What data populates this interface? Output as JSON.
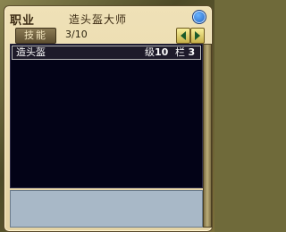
{
  "window": {
    "title": "职业",
    "subtitle": "造头盔大师"
  },
  "header": {
    "tab_label": "技能",
    "count": "3/10"
  },
  "list": {
    "rows": [
      {
        "name": "造头盔",
        "level_label": "级",
        "level": "10",
        "slot_label": "栏",
        "slot": "3"
      }
    ]
  },
  "colors": {
    "list_bg": "#030317",
    "panel_bg": "#e8d8a8",
    "desc_bg": "#a8b8c7",
    "accent_blue": "#1e5ebd"
  },
  "icons": {
    "close": "close-icon",
    "prev": "chevron-left-icon",
    "next": "chevron-right-icon"
  }
}
